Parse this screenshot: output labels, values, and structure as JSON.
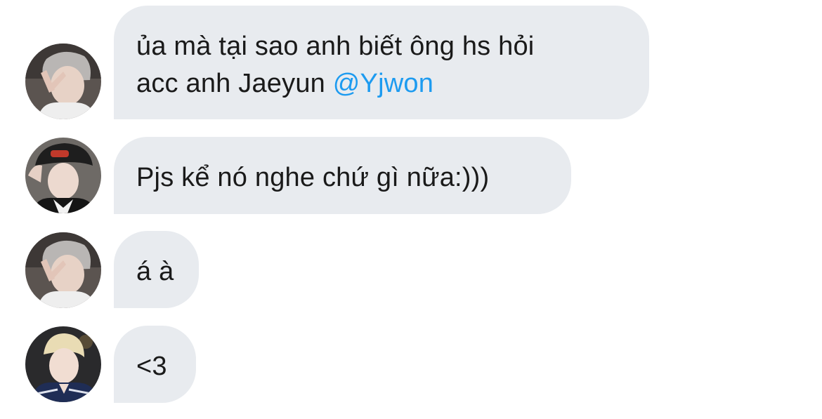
{
  "messages": [
    {
      "sender_avatar": "avatar-gray-hair-peace-sign",
      "lines": [
        "ủa mà tại sao anh biết ông hs hỏi",
        "acc anh Jaeyun "
      ],
      "mention": "@Yjwon"
    },
    {
      "sender_avatar": "avatar-black-cap",
      "lines": [
        "Pjs kể nó nghe chứ gì nữa:)))"
      ]
    },
    {
      "sender_avatar": "avatar-gray-hair-peace-sign",
      "lines": [
        "á à"
      ]
    },
    {
      "sender_avatar": "avatar-blonde-navy-jacket",
      "lines": [
        "<3"
      ]
    }
  ],
  "colors": {
    "bubble_background": "#e8ebef",
    "message_text": "#1a1a1a",
    "mention": "#1d9bf0",
    "page_background": "#ffffff"
  }
}
